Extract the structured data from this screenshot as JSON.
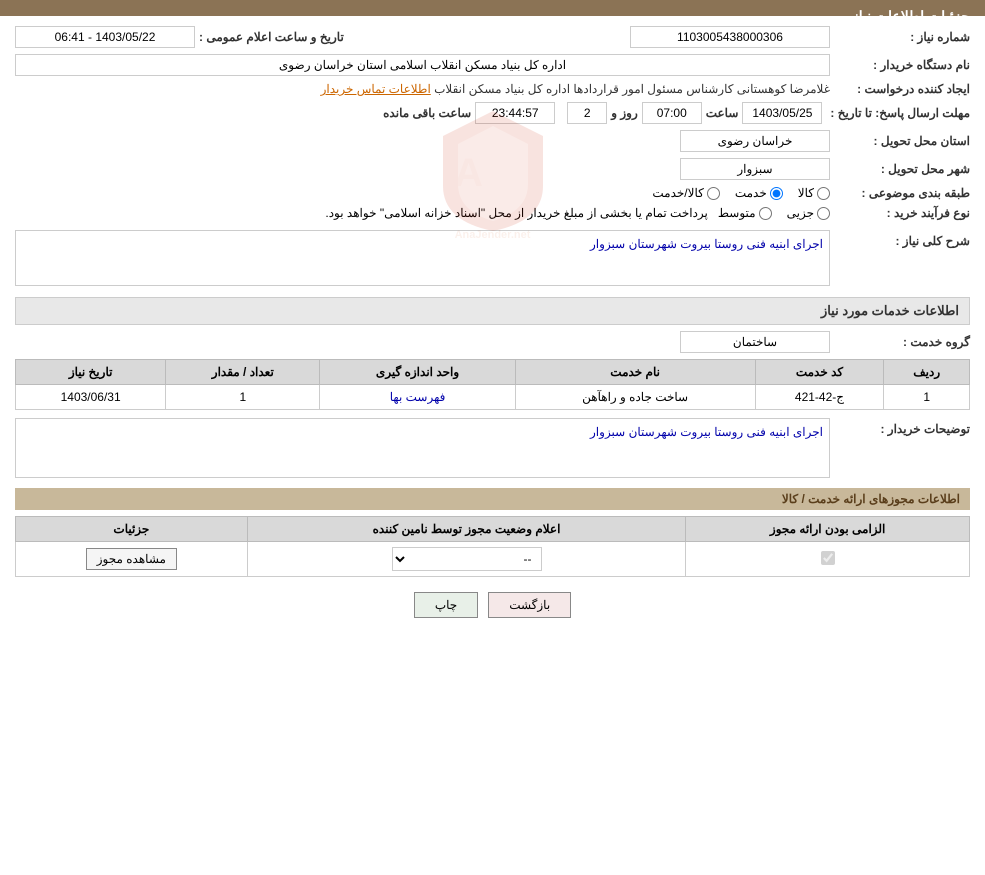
{
  "header": {
    "title": "جزئیات اطلاعات نیاز"
  },
  "fields": {
    "shomara_niaz_label": "شماره نیاز :",
    "shomara_niaz_value": "1103005438000306",
    "nam_dastgah_label": "نام دستگاه خریدار :",
    "nam_dastgah_value": "اداره کل بنیاد مسکن انقلاب اسلامی استان خراسان رضوی",
    "ijad_konande_label": "ایجاد کننده درخواست :",
    "ijad_konande_name": "غلامرضا کوهستانی کارشناس مسئول امور قراردادها اداره کل بنیاد مسکن انقلاب",
    "ijad_konande_link": "اطلاعات تماس خریدار",
    "mohlat_ersal_label": "مهلت ارسال پاسخ: تا تاریخ :",
    "date_value": "1403/05/25",
    "saat_label": "ساعت",
    "saat_value": "07:00",
    "rooz_label": "روز و",
    "rooz_value": "2",
    "baqi_label": "ساعت باقی مانده",
    "baqi_value": "23:44:57",
    "ostan_tahvil_label": "استان محل تحویل :",
    "ostan_tahvil_value": "خراسان رضوی",
    "shahr_tahvil_label": "شهر محل تحویل :",
    "shahr_tahvil_value": "سبزوار",
    "tabaqe_label": "طبقه بندی موضوعی :",
    "radio_kala": "کالا",
    "radio_khadamat": "خدمت",
    "radio_kala_khadamat": "کالا/خدمت",
    "radio_selected": "khadamat",
    "nove_farayand_label": "نوع فرآیند خرید :",
    "radio_jazii": "جزیی",
    "radio_motavasset": "متوسط",
    "farayand_text": "پرداخت تمام یا بخشی از مبلغ خریدار از محل \"اسناد خزانه اسلامی\" خواهد بود.",
    "tarikh_label": "تاریخ و ساعت اعلام عمومی :",
    "tarikh_value": "1403/05/22 - 06:41",
    "sharh_label": "شرح کلی نیاز :",
    "sharh_value": "اجرای ابنیه فنی روستا بیروت شهرستان سبزوار",
    "info_khadamat_title": "اطلاعات خدمات مورد نیاز",
    "gorooh_label": "گروه خدمت :",
    "gorooh_value": "ساختمان",
    "table_headers": {
      "radif": "ردیف",
      "code_khadamat": "کد خدمت",
      "name_khadamat": "نام خدمت",
      "vahed": "واحد اندازه گیری",
      "tedad": "تعداد / مقدار",
      "tarikh_niaz": "تاریخ نیاز"
    },
    "table_rows": [
      {
        "radif": "1",
        "code_khadamat": "ج-42-421",
        "name_khadamat": "ساخت جاده و راهآهن",
        "vahed": "فهرست بها",
        "tedad": "1",
        "tarikh_niaz": "1403/06/31"
      }
    ],
    "tosihaat_label": "توضیحات خریدار :",
    "tosihaat_value": "اجرای ابنیه فنی روستا بیروت شهرستان سبزوار",
    "mojavez_title": "اطلاعات مجوزهای ارائه خدمت / کالا",
    "table2_headers": {
      "elzami": "الزامی بودن ارائه مجوز",
      "elam": "اعلام وضعیت مجوز توسط نامین کننده",
      "joziyat": "جزئیات"
    },
    "table2_rows": [
      {
        "elzami_checked": true,
        "elam_value": "--",
        "joziyat_btn": "مشاهده مجوز"
      }
    ],
    "btn_print": "چاپ",
    "btn_back": "بازگشت"
  }
}
